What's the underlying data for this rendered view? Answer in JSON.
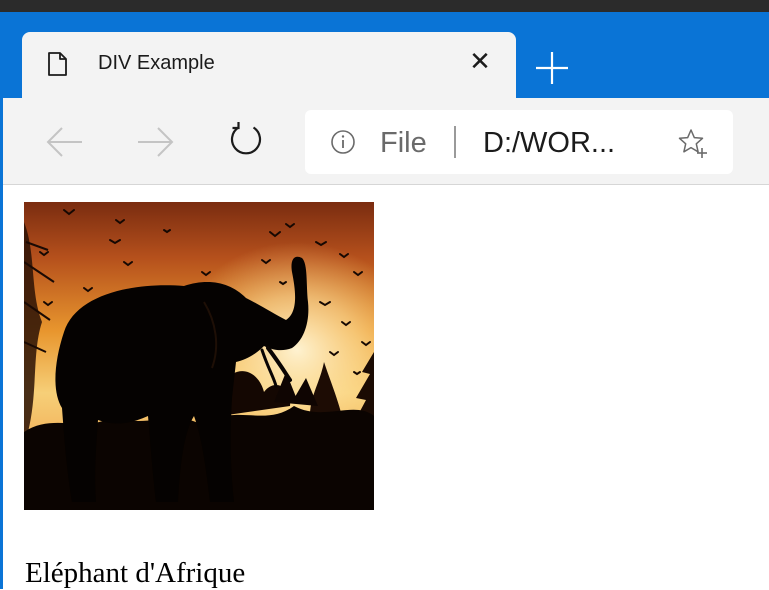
{
  "browser": {
    "tab": {
      "title": "DIV Example",
      "close_glyph": "✕",
      "icon": "page-icon"
    },
    "new_tab_icon": "plus-icon",
    "toolbar": {
      "back_icon": "back-arrow-icon",
      "forward_icon": "forward-arrow-icon",
      "refresh_icon": "refresh-icon"
    },
    "address_bar": {
      "info_icon": "info-icon",
      "scheme_label": "File",
      "url": "D:/WOR...",
      "favorite_icon": "add-favorite-icon"
    },
    "colors": {
      "tabstrip": "#0a74d6",
      "titlebar": "#2b2b2b",
      "toolbar": "#f3f3f3"
    }
  },
  "page": {
    "image": {
      "subject": "elephant-silhouette-sunset"
    },
    "caption": "Eléphant d'Afrique"
  }
}
